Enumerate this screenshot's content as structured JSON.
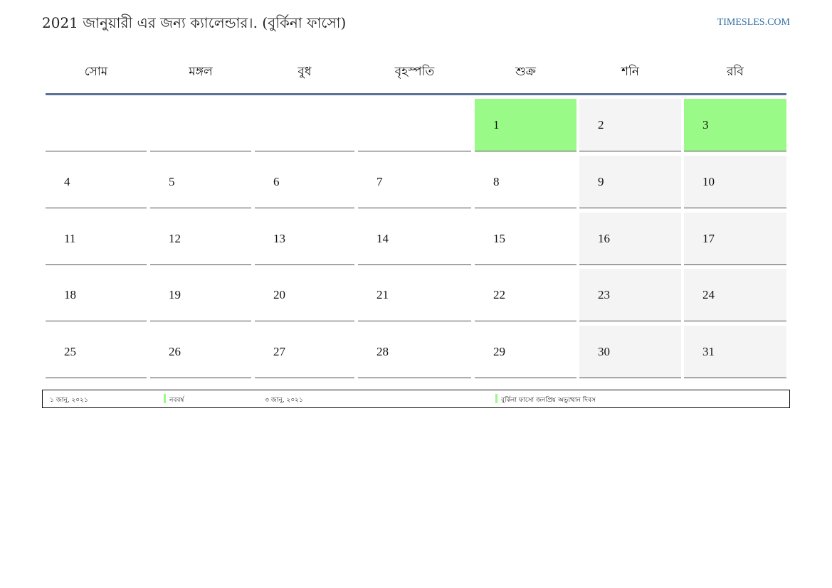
{
  "page": {
    "title": "2021 জানুয়ারী এর জন্য ক্যালেন্ডার।. (বুর্কিনা ফাসো)",
    "site": "TIMESLES.COM"
  },
  "weekdays": [
    "সোম",
    "মঙ্গল",
    "বুধ",
    "বৃহস্পতি",
    "শুক্র",
    "শনি",
    "রবি"
  ],
  "weeks": [
    [
      "",
      "",
      "",
      "",
      "1",
      "2",
      "3"
    ],
    [
      "4",
      "5",
      "6",
      "7",
      "8",
      "9",
      "10"
    ],
    [
      "11",
      "12",
      "13",
      "14",
      "15",
      "16",
      "17"
    ],
    [
      "18",
      "19",
      "20",
      "21",
      "22",
      "23",
      "24"
    ],
    [
      "25",
      "26",
      "27",
      "28",
      "29",
      "30",
      "31"
    ]
  ],
  "holidays": [
    "1",
    "3"
  ],
  "colors": {
    "holiday": "#9afa87",
    "weekend": "#f4f4f4",
    "header_rule": "#5a7296",
    "link": "#2e6da4"
  },
  "legend": [
    {
      "date": "১ জানু, ২০২১",
      "name": "নববর্ষ"
    },
    {
      "date": "৩ জানু, ২০২১",
      "name": "বুর্কিনা ফাসো জনপ্রিয় অভ্যুত্থান দিবস"
    }
  ]
}
